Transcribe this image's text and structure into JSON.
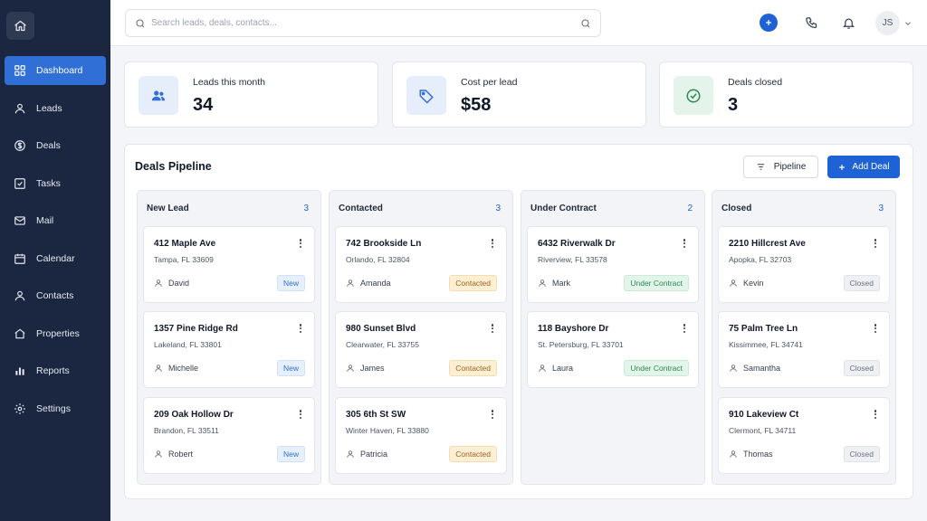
{
  "sidebar": {
    "home_icon": "home-icon",
    "items": [
      {
        "label": "Dashboard",
        "icon": "grid-icon",
        "active": true
      },
      {
        "label": "Leads",
        "icon": "user-icon"
      },
      {
        "label": "Deals",
        "icon": "dollar-icon"
      },
      {
        "label": "Tasks",
        "icon": "checkbox-icon"
      },
      {
        "label": "Mail",
        "icon": "mail-icon"
      },
      {
        "label": "Calendar",
        "icon": "calendar-icon"
      },
      {
        "label": "Contacts",
        "icon": "contact-icon"
      },
      {
        "label": "Properties",
        "icon": "house-icon"
      },
      {
        "label": "Reports",
        "icon": "bar-chart-icon"
      },
      {
        "label": "Settings",
        "icon": "gear-icon"
      }
    ]
  },
  "topbar": {
    "search_placeholder": "Search leads, deals, contacts...",
    "avatar_initials": "JS"
  },
  "stats": [
    {
      "label": "Leads this month",
      "value": "34",
      "icon": "users-icon"
    },
    {
      "label": "Cost per lead",
      "value": "$58",
      "icon": "tag-icon"
    },
    {
      "label": "Deals closed",
      "value": "3",
      "icon": "check-circle-icon"
    }
  ],
  "pipeline": {
    "title": "Deals Pipeline",
    "filter_label": "Pipeline",
    "add_label": "Add Deal",
    "columns": [
      {
        "title": "New Lead",
        "count": "3",
        "cards": [
          {
            "address": "412 Maple Ave",
            "city": "Tampa, FL 33609",
            "person": "David",
            "status": "New"
          },
          {
            "address": "1357 Pine Ridge Rd",
            "city": "Lakeland, FL 33801",
            "person": "Michelle",
            "status": "New"
          },
          {
            "address": "209 Oak Hollow Dr",
            "city": "Brandon, FL 33511",
            "person": "Robert",
            "status": "New"
          }
        ]
      },
      {
        "title": "Contacted",
        "count": "3",
        "cards": [
          {
            "address": "742 Brookside Ln",
            "city": "Orlando, FL 32804",
            "person": "Amanda",
            "status": "Contacted"
          },
          {
            "address": "980 Sunset Blvd",
            "city": "Clearwater, FL 33755",
            "person": "James",
            "status": "Contacted"
          },
          {
            "address": "305 6th St SW",
            "city": "Winter Haven, FL 33880",
            "person": "Patricia",
            "status": "Contacted"
          }
        ]
      },
      {
        "title": "Under Contract",
        "count": "2",
        "cards": [
          {
            "address": "6432 Riverwalk Dr",
            "city": "Riverview, FL 33578",
            "person": "Mark",
            "status": "Under Contract"
          },
          {
            "address": "118 Bayshore Dr",
            "city": "St. Petersburg, FL 33701",
            "person": "Laura",
            "status": "Under Contract"
          }
        ]
      },
      {
        "title": "Closed",
        "count": "3",
        "cards": [
          {
            "address": "2210 Hillcrest Ave",
            "city": "Apopka, FL 32703",
            "person": "Kevin",
            "status": "Closed"
          },
          {
            "address": "75 Palm Tree Ln",
            "city": "Kissimmee, FL 34741",
            "person": "Samantha",
            "status": "Closed"
          },
          {
            "address": "910 Lakeview Ct",
            "city": "Clermont, FL 34711",
            "person": "Thomas",
            "status": "Closed"
          }
        ]
      }
    ]
  },
  "colors": {
    "sidebar_bg": "#1b2740",
    "accent": "#1f62d6",
    "new_badge": "#2f6fd6",
    "contacted_badge": "#a0621a",
    "under_contract_badge": "#2b8a4d",
    "closed_badge": "#6b7280"
  }
}
